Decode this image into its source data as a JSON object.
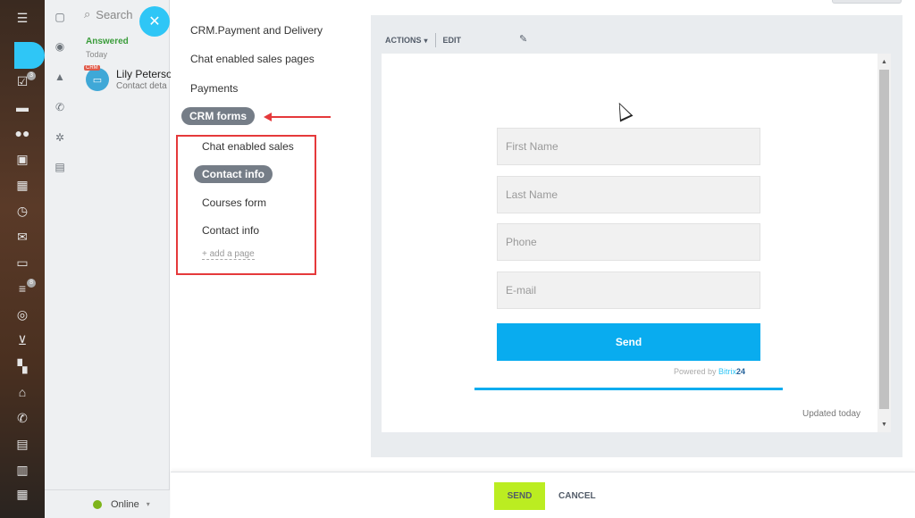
{
  "iconbar": {
    "items": [
      {
        "icon": "menu-icon"
      },
      {
        "icon": "feed-icon"
      },
      {
        "icon": "tasks-icon",
        "badge": "3"
      },
      {
        "icon": "chat-icon"
      },
      {
        "icon": "groups-icon"
      },
      {
        "icon": "contacts-card-icon"
      },
      {
        "icon": "calendar-widget-icon"
      },
      {
        "icon": "clock-icon"
      },
      {
        "icon": "mail-icon"
      },
      {
        "icon": "window-icon"
      },
      {
        "icon": "funnel-icon",
        "badge": "8"
      },
      {
        "icon": "target-icon"
      },
      {
        "icon": "cart-icon"
      },
      {
        "icon": "apps-grid-icon"
      },
      {
        "icon": "bank-icon"
      },
      {
        "icon": "phone-icon"
      },
      {
        "icon": "inbox-icon"
      },
      {
        "icon": "document-icon"
      },
      {
        "icon": "calendar-icon"
      }
    ]
  },
  "contacts": {
    "search_label": "Search",
    "section_label": "Answered",
    "date_label": "Today",
    "crm_tag": "CRM",
    "contact_name": "Lily Peterso",
    "contact_detail": "Contact deta",
    "status_label": "Online"
  },
  "pages": {
    "items": [
      {
        "label": "CRM.Payment and Delivery"
      },
      {
        "label": "Chat enabled sales pages"
      },
      {
        "label": "Payments"
      },
      {
        "label": "CRM forms",
        "selected": true
      }
    ],
    "subitems": [
      {
        "label": "Chat enabled sales"
      },
      {
        "label": "Contact info",
        "selected": true
      },
      {
        "label": "Courses form"
      },
      {
        "label": "Contact info"
      }
    ],
    "add_page_label": "+ add a page"
  },
  "preview": {
    "actions_label": "ACTIONS",
    "edit_label": "EDIT",
    "form": {
      "fields": [
        {
          "placeholder": "First Name"
        },
        {
          "placeholder": "Last Name"
        },
        {
          "placeholder": "Phone"
        },
        {
          "placeholder": "E-mail"
        }
      ],
      "submit_label": "Send",
      "powered_label": "Powered by",
      "brand_part1": "Bitrix",
      "brand_part2": "24"
    },
    "updated_label": "Updated today"
  },
  "footer": {
    "send_label": "SEND",
    "cancel_label": "CANCEL"
  },
  "colors": {
    "accent": "#2fc6f6",
    "send_button": "#bbed21",
    "form_button": "#09acef",
    "annotation_red": "#e5393b"
  }
}
